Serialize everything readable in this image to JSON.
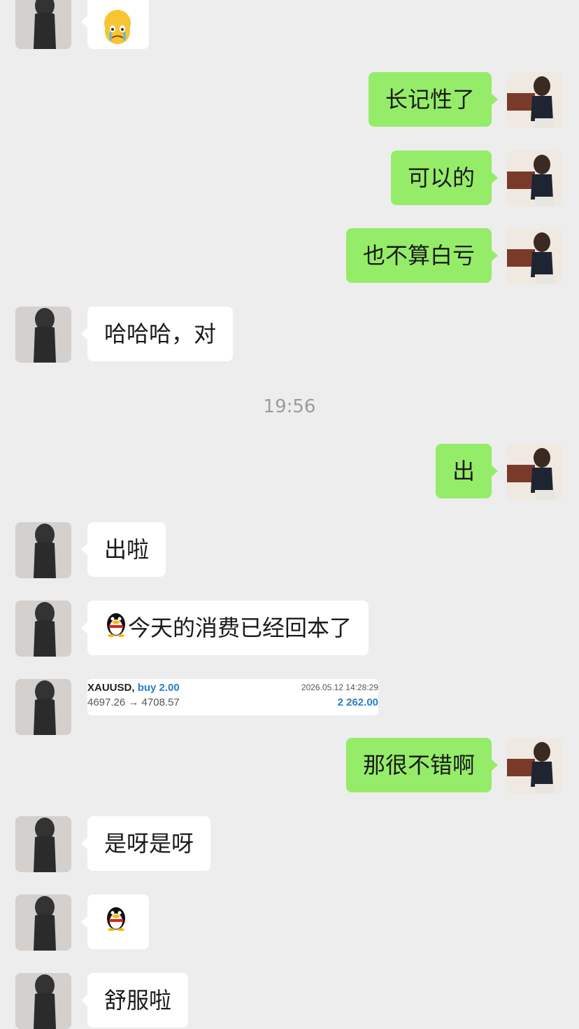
{
  "messages": [
    {
      "side": "left",
      "type": "emoji",
      "icon": "crying-face-emoji"
    },
    {
      "side": "right",
      "text": "长记性了"
    },
    {
      "side": "right",
      "text": "可以的"
    },
    {
      "side": "right",
      "text": "也不算白亏"
    },
    {
      "side": "left",
      "text": "哈哈哈，对"
    },
    {
      "side": "right",
      "text": "出"
    },
    {
      "side": "left",
      "text": "出啦"
    },
    {
      "side": "left",
      "text": "今天的消费已经回本了",
      "icon": "qq-penguin-emoji"
    },
    {
      "side": "left",
      "type": "trade-card"
    },
    {
      "side": "right",
      "text": "那很不错啊"
    },
    {
      "side": "left",
      "text": "是呀是呀"
    },
    {
      "side": "left",
      "type": "emoji",
      "icon": "qq-penguin-emoji"
    },
    {
      "side": "left",
      "text": "舒服啦"
    }
  ],
  "timestamp": "19:56",
  "trade": {
    "symbol": "XAUUSD,",
    "side": "buy 2.00",
    "datetime": "2026.05.12 14:28:29",
    "price_move": "4697.26 → 4708.57",
    "profit": "2 262.00"
  },
  "colors": {
    "background": "#ededed",
    "sent_bubble": "#95ec69",
    "received_bubble": "#ffffff",
    "profit": "#2a7fc9"
  }
}
